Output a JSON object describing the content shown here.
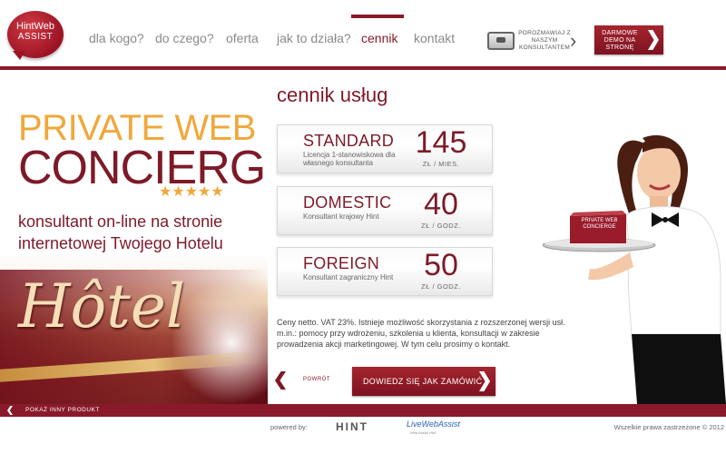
{
  "logo": {
    "top": "HintWeb",
    "bottom": "ASSIST"
  },
  "nav": {
    "items": [
      "dla kogo?",
      "do czego?",
      "oferta",
      "jak to działa?",
      "cennik",
      "kontakt"
    ],
    "active": "cennik"
  },
  "chat": {
    "text": "POROZMAWIAJ Z NASZYM KONSULTANTEM"
  },
  "demo_button": {
    "label": "DARMOWE DEMO NA STRONĘ"
  },
  "hero": {
    "line1": "PRIVATE WEB",
    "line2": "CONCIERGE",
    "stars": "★★★★★",
    "tagline": "konsultant on-line na stronie internetowej Twojego Hotelu",
    "sign": "Hôtel"
  },
  "pricing": {
    "title": "cennik usług",
    "plans": [
      {
        "name": "STANDARD",
        "desc": "Licencja 1-stanowiskowa dla własnego konsultanta",
        "price": "145",
        "unit": "ZŁ / MIES."
      },
      {
        "name": "DOMESTIC",
        "desc": "Konsultant krajowy Hint",
        "price": "40",
        "unit": "ZŁ / GODZ."
      },
      {
        "name": "FOREIGN",
        "desc": "Konsultant zagraniczny Hint",
        "price": "50",
        "unit": "ZŁ / GODZ."
      }
    ],
    "note": "Ceny netto. VAT 23%. Istnieje możliwość skorzystania z rozszerzonej wersji usł. m.in.: pomocy przy wdrożeniu, szkolenia u klienta, konsultacji w zakresie prowadzenia akcji marketingowej. W tym celu prosimy o kontakt.",
    "back": "POWRÓT",
    "order_button": "DOWIEDZ SIĘ JAK ZAMÓWIĆ"
  },
  "tray_card": {
    "line1": "PRIVATE WEB",
    "line2": "CONCIERGE"
  },
  "footer": {
    "link": "POKAŻ INNY PRODUKT",
    "powered": "powered by:",
    "hint_logo": "HINT",
    "lwa_logo": "LiveWebAssist",
    "lwa_sub": "Web Assist Hint",
    "rights": "Wszelkie prawa zastrzeżone © 2012"
  },
  "colors": {
    "brand": "#8a1a2b",
    "accent": "#f0a83c"
  }
}
